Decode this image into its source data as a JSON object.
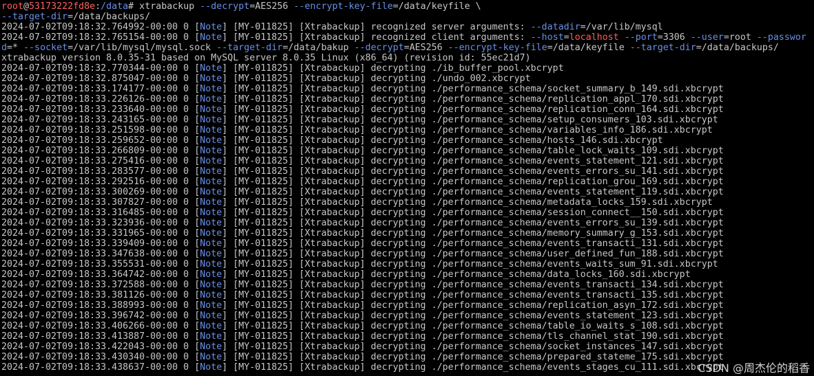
{
  "colors": {
    "background": "#000000",
    "text": "#c7c7c7",
    "user": "#ff5f5f",
    "path": "#6a8fe6",
    "note": "#6a8fe6",
    "option": "#6a8fe6",
    "value": "#ff5f5f"
  },
  "watermark": "CSDN @周杰伦的稻香",
  "lines": [
    {
      "segs": [
        [
          "user",
          "root"
        ],
        [
          "",
          "@"
        ],
        [
          "user",
          "53173222fd8e"
        ],
        [
          "",
          ":"
        ],
        [
          "path",
          "/data"
        ],
        [
          "",
          "# xtrabackup "
        ],
        [
          "opt",
          "--decrypt"
        ],
        [
          "",
          "=AES256 "
        ],
        [
          "opt",
          "--encrypt-key-file"
        ],
        [
          "",
          "=/data/keyfile \\"
        ]
      ]
    },
    {
      "segs": [
        [
          "opt",
          "--target-dir"
        ],
        [
          "",
          "=/data/backups/"
        ]
      ]
    },
    {
      "segs": [
        [
          "",
          "2024-07-02T09:18:32.764992-00:00 0 ["
        ],
        [
          "note",
          "Note"
        ],
        [
          "",
          "] [MY-011825] [Xtrabackup] recognized server arguments: "
        ],
        [
          "opt",
          "--datadir"
        ],
        [
          "",
          "=/var/lib/mysql"
        ]
      ]
    },
    {
      "segs": [
        [
          "",
          "2024-07-02T09:18:32.765154-00:00 0 ["
        ],
        [
          "note",
          "Note"
        ],
        [
          "",
          "] [MY-011825] [Xtrabackup] recognized client arguments: "
        ],
        [
          "opt",
          "--host"
        ],
        [
          "",
          "="
        ],
        [
          "val",
          "localhost"
        ],
        [
          "",
          ""
        ],
        [
          "opt",
          " --port"
        ],
        [
          "",
          "=3306 "
        ],
        [
          "opt",
          "--user"
        ],
        [
          "",
          "=root "
        ],
        [
          "opt",
          "--passwor"
        ]
      ]
    },
    {
      "segs": [
        [
          "opt",
          "d"
        ],
        [
          "",
          "=* "
        ],
        [
          "opt",
          "--socket"
        ],
        [
          "",
          "=/var/lib/mysql/mysql.sock "
        ],
        [
          "opt",
          "--target-dir"
        ],
        [
          "",
          "=/data/bakup "
        ],
        [
          "opt",
          "--decrypt"
        ],
        [
          "",
          "=AES256 "
        ],
        [
          "opt",
          "--encrypt-key-file"
        ],
        [
          "",
          "=/data/keyfile "
        ],
        [
          "opt",
          "--target-dir"
        ],
        [
          "",
          "=/data/backups/"
        ]
      ]
    },
    {
      "segs": [
        [
          "",
          "xtrabackup version 8.0.35-31 based on MySQL server 8.0.35 Linux (x86_64) (revision id: 55ec21d7)"
        ]
      ]
    },
    {
      "segs": [
        [
          "",
          "2024-07-02T09:18:32.770344-00:00 0 ["
        ],
        [
          "note",
          "Note"
        ],
        [
          "",
          "] [MY-011825] [Xtrabackup] decrypting ./ib_buffer_pool.xbcrypt"
        ]
      ]
    },
    {
      "segs": [
        [
          "",
          "2024-07-02T09:18:32.875047-00:00 0 ["
        ],
        [
          "note",
          "Note"
        ],
        [
          "",
          "] [MY-011825] [Xtrabackup] decrypting ./undo_002.xbcrypt"
        ]
      ]
    },
    {
      "segs": [
        [
          "",
          "2024-07-02T09:18:33.174177-00:00 0 ["
        ],
        [
          "note",
          "Note"
        ],
        [
          "",
          "] [MY-011825] [Xtrabackup] decrypting ./performance_schema/socket_summary_b_149.sdi.xbcrypt"
        ]
      ]
    },
    {
      "segs": [
        [
          "",
          "2024-07-02T09:18:33.226126-00:00 0 ["
        ],
        [
          "note",
          "Note"
        ],
        [
          "",
          "] [MY-011825] [Xtrabackup] decrypting ./performance_schema/replication_appl_170.sdi.xbcrypt"
        ]
      ]
    },
    {
      "segs": [
        [
          "",
          "2024-07-02T09:18:33.233640-00:00 0 ["
        ],
        [
          "note",
          "Note"
        ],
        [
          "",
          "] [MY-011825] [Xtrabackup] decrypting ./performance_schema/replication_conn_164.sdi.xbcrypt"
        ]
      ]
    },
    {
      "segs": [
        [
          "",
          "2024-07-02T09:18:33.243165-00:00 0 ["
        ],
        [
          "note",
          "Note"
        ],
        [
          "",
          "] [MY-011825] [Xtrabackup] decrypting ./performance_schema/setup_consumers_103.sdi.xbcrypt"
        ]
      ]
    },
    {
      "segs": [
        [
          "",
          "2024-07-02T09:18:33.251598-00:00 0 ["
        ],
        [
          "note",
          "Note"
        ],
        [
          "",
          "] [MY-011825] [Xtrabackup] decrypting ./performance_schema/variables_info_186.sdi.xbcrypt"
        ]
      ]
    },
    {
      "segs": [
        [
          "",
          "2024-07-02T09:18:33.259652-00:00 0 ["
        ],
        [
          "note",
          "Note"
        ],
        [
          "",
          "] [MY-011825] [Xtrabackup] decrypting ./performance_schema/hosts_146.sdi.xbcrypt"
        ]
      ]
    },
    {
      "segs": [
        [
          "",
          "2024-07-02T09:18:33.266809-00:00 0 ["
        ],
        [
          "note",
          "Note"
        ],
        [
          "",
          "] [MY-011825] [Xtrabackup] decrypting ./performance_schema/table_lock_waits_109.sdi.xbcrypt"
        ]
      ]
    },
    {
      "segs": [
        [
          "",
          "2024-07-02T09:18:33.275416-00:00 0 ["
        ],
        [
          "note",
          "Note"
        ],
        [
          "",
          "] [MY-011825] [Xtrabackup] decrypting ./performance_schema/events_statement_121.sdi.xbcrypt"
        ]
      ]
    },
    {
      "segs": [
        [
          "",
          "2024-07-02T09:18:33.283577-00:00 0 ["
        ],
        [
          "note",
          "Note"
        ],
        [
          "",
          "] [MY-011825] [Xtrabackup] decrypting ./performance_schema/events_errors_su_141.sdi.xbcrypt"
        ]
      ]
    },
    {
      "segs": [
        [
          "",
          "2024-07-02T09:18:33.292516-00:00 0 ["
        ],
        [
          "note",
          "Note"
        ],
        [
          "",
          "] [MY-011825] [Xtrabackup] decrypting ./performance_schema/replication_grou_169.sdi.xbcrypt"
        ]
      ]
    },
    {
      "segs": [
        [
          "",
          "2024-07-02T09:18:33.300269-00:00 0 ["
        ],
        [
          "note",
          "Note"
        ],
        [
          "",
          "] [MY-011825] [Xtrabackup] decrypting ./performance_schema/events_statement_119.sdi.xbcrypt"
        ]
      ]
    },
    {
      "segs": [
        [
          "",
          "2024-07-02T09:18:33.307827-00:00 0 ["
        ],
        [
          "note",
          "Note"
        ],
        [
          "",
          "] [MY-011825] [Xtrabackup] decrypting ./performance_schema/metadata_locks_159.sdi.xbcrypt"
        ]
      ]
    },
    {
      "segs": [
        [
          "",
          "2024-07-02T09:18:33.316485-00:00 0 ["
        ],
        [
          "note",
          "Note"
        ],
        [
          "",
          "] [MY-011825] [Xtrabackup] decrypting ./performance_schema/session_connect__150.sdi.xbcrypt"
        ]
      ]
    },
    {
      "segs": [
        [
          "",
          "2024-07-02T09:18:33.323936-00:00 0 ["
        ],
        [
          "note",
          "Note"
        ],
        [
          "",
          "] [MY-011825] [Xtrabackup] decrypting ./performance_schema/events_errors_su_139.sdi.xbcrypt"
        ]
      ]
    },
    {
      "segs": [
        [
          "",
          "2024-07-02T09:18:33.331965-00:00 0 ["
        ],
        [
          "note",
          "Note"
        ],
        [
          "",
          "] [MY-011825] [Xtrabackup] decrypting ./performance_schema/memory_summary_g_153.sdi.xbcrypt"
        ]
      ]
    },
    {
      "segs": [
        [
          "",
          "2024-07-02T09:18:33.339409-00:00 0 ["
        ],
        [
          "note",
          "Note"
        ],
        [
          "",
          "] [MY-011825] [Xtrabackup] decrypting ./performance_schema/events_transacti_131.sdi.xbcrypt"
        ]
      ]
    },
    {
      "segs": [
        [
          "",
          "2024-07-02T09:18:33.347638-00:00 0 ["
        ],
        [
          "note",
          "Note"
        ],
        [
          "",
          "] [MY-011825] [Xtrabackup] decrypting ./performance_schema/user_defined_fun_188.sdi.xbcrypt"
        ]
      ]
    },
    {
      "segs": [
        [
          "",
          "2024-07-02T09:18:33.355531-00:00 0 ["
        ],
        [
          "note",
          "Note"
        ],
        [
          "",
          "] [MY-011825] [Xtrabackup] decrypting ./performance_schema/events_waits_sum_91.sdi.xbcrypt"
        ]
      ]
    },
    {
      "segs": [
        [
          "",
          "2024-07-02T09:18:33.364742-00:00 0 ["
        ],
        [
          "note",
          "Note"
        ],
        [
          "",
          "] [MY-011825] [Xtrabackup] decrypting ./performance_schema/data_locks_160.sdi.xbcrypt"
        ]
      ]
    },
    {
      "segs": [
        [
          "",
          "2024-07-02T09:18:33.372588-00:00 0 ["
        ],
        [
          "note",
          "Note"
        ],
        [
          "",
          "] [MY-011825] [Xtrabackup] decrypting ./performance_schema/events_transacti_134.sdi.xbcrypt"
        ]
      ]
    },
    {
      "segs": [
        [
          "",
          "2024-07-02T09:18:33.381126-00:00 0 ["
        ],
        [
          "note",
          "Note"
        ],
        [
          "",
          "] [MY-011825] [Xtrabackup] decrypting ./performance_schema/events_transacti_135.sdi.xbcrypt"
        ]
      ]
    },
    {
      "segs": [
        [
          "",
          "2024-07-02T09:18:33.388993-00:00 0 ["
        ],
        [
          "note",
          "Note"
        ],
        [
          "",
          "] [MY-011825] [Xtrabackup] decrypting ./performance_schema/replication_asyn_172.sdi.xbcrypt"
        ]
      ]
    },
    {
      "segs": [
        [
          "",
          "2024-07-02T09:18:33.396742-00:00 0 ["
        ],
        [
          "note",
          "Note"
        ],
        [
          "",
          "] [MY-011825] [Xtrabackup] decrypting ./performance_schema/events_statement_123.sdi.xbcrypt"
        ]
      ]
    },
    {
      "segs": [
        [
          "",
          "2024-07-02T09:18:33.406266-00:00 0 ["
        ],
        [
          "note",
          "Note"
        ],
        [
          "",
          "] [MY-011825] [Xtrabackup] decrypting ./performance_schema/table_io_waits_s_108.sdi.xbcrypt"
        ]
      ]
    },
    {
      "segs": [
        [
          "",
          "2024-07-02T09:18:33.413887-00:00 0 ["
        ],
        [
          "note",
          "Note"
        ],
        [
          "",
          "] [MY-011825] [Xtrabackup] decrypting ./performance_schema/tls_channel_stat_190.sdi.xbcrypt"
        ]
      ]
    },
    {
      "segs": [
        [
          "",
          "2024-07-02T09:18:33.422043-00:00 0 ["
        ],
        [
          "note",
          "Note"
        ],
        [
          "",
          "] [MY-011825] [Xtrabackup] decrypting ./performance_schema/socket_instances_147.sdi.xbcrypt"
        ]
      ]
    },
    {
      "segs": [
        [
          "",
          "2024-07-02T09:18:33.430340-00:00 0 ["
        ],
        [
          "note",
          "Note"
        ],
        [
          "",
          "] [MY-011825] [Xtrabackup] decrypting ./performance_schema/prepared_stateme_175.sdi.xbcrypt"
        ]
      ]
    },
    {
      "segs": [
        [
          "",
          "2024-07-02T09:18:33.438637-00:00 0 ["
        ],
        [
          "note",
          "Note"
        ],
        [
          "",
          "] [MY-011825] [Xtrabackup] decrypting ./performance_schema/events_stages_cu_111.sdi.xbcrypt"
        ]
      ]
    }
  ]
}
